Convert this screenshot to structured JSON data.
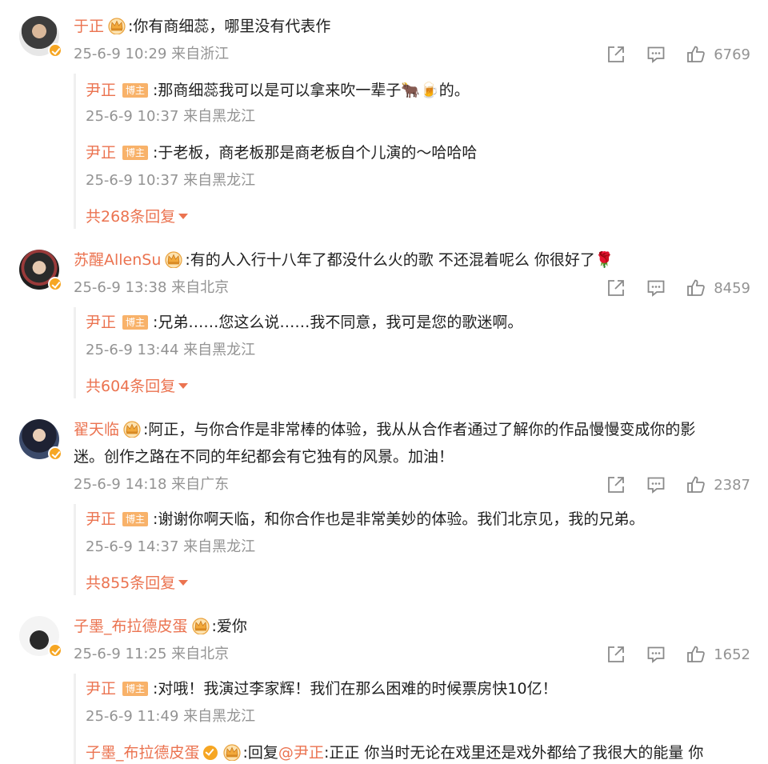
{
  "comments": [
    {
      "user": "于正",
      "text": ":你有商细蕊，哪里没有代表作",
      "meta": "25-6-9 10:29 来自浙江",
      "likes": "6769",
      "replies": [
        {
          "user": "尹正",
          "badge": "博主",
          "text": ":那商细蕊我可以是可以拿来吹一辈子🐂🍺的。",
          "meta": "25-6-9 10:37 来自黑龙江"
        },
        {
          "user": "尹正",
          "badge": "博主",
          "text": ":于老板，商老板那是商老板自个儿演的～哈哈哈",
          "meta": "25-6-9 10:37 来自黑龙江"
        }
      ],
      "more": "共268条回复"
    },
    {
      "user": "苏醒AllenSu",
      "text": ":有的人入行十八年了都没什么火的歌 不还混着呢么 你很好了🌹",
      "meta": "25-6-9 13:38 来自北京",
      "likes": "8459",
      "replies": [
        {
          "user": "尹正",
          "badge": "博主",
          "text": ":兄弟……您这么说……我不同意，我可是您的歌迷啊。",
          "meta": "25-6-9 13:44 来自黑龙江"
        }
      ],
      "more": "共604条回复"
    },
    {
      "user": "翟天临",
      "text_line1": ":阿正，与你合作是非常棒的体验，我从从合作者通过了解你的作品慢慢变成你的影",
      "text_line2": "迷。创作之路在不同的年纪都会有它独有的风景。加油！",
      "meta": "25-6-9 14:18 来自广东",
      "likes": "2387",
      "replies": [
        {
          "user": "尹正",
          "badge": "博主",
          "text": ":谢谢你啊天临，和你合作也是非常美妙的体验。我们北京见，我的兄弟。",
          "meta": "25-6-9 14:37 来自黑龙江"
        }
      ],
      "more": "共855条回复"
    },
    {
      "user": "子墨_布拉德皮蛋",
      "text": ":爱你",
      "meta": "25-6-9 11:25 来自北京",
      "likes": "1652",
      "replies": [
        {
          "user": "尹正",
          "badge": "博主",
          "text": ":对哦！我演过李家辉！我们在那么困难的时候票房快10亿！",
          "meta": "25-6-9 11:49 来自黑龙江"
        },
        {
          "user": "子墨_布拉德皮蛋",
          "text_prefix": ":回复",
          "mention": "@尹正",
          "text": ":正正 你当时无论在戏里还是戏外都给了我很大的能量 你"
        }
      ]
    }
  ],
  "icons": {
    "share": "share-icon",
    "comment": "comment-icon",
    "like": "like-icon",
    "crown": "crown-icon",
    "verified": "verified-icon"
  },
  "colors": {
    "name": "#eb7350",
    "meta": "#939393",
    "badge": "#f8b26a",
    "verified": "#f6a623"
  }
}
